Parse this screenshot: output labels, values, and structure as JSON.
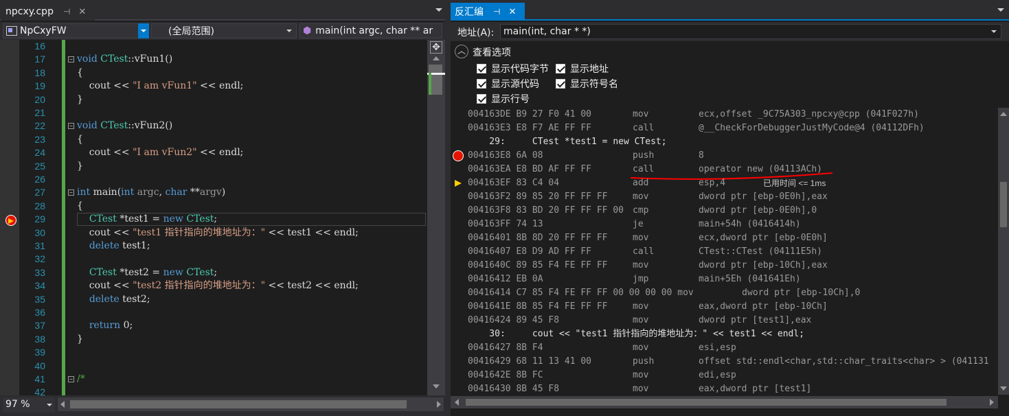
{
  "left_tab": {
    "title": "npcxy.cpp",
    "pin": "⊣",
    "close": "✕"
  },
  "nav": {
    "project": "NpCxyFW",
    "scope": "(全局范围)",
    "member": "main(int argc, char ** ar"
  },
  "code_lines": [
    {
      "n": "16",
      "parts": []
    },
    {
      "n": "17",
      "fold": "−",
      "parts": [
        [
          "kw",
          "void "
        ],
        [
          "ty",
          "CTest"
        ],
        [
          "",
          "::vFun1()"
        ]
      ]
    },
    {
      "n": "18",
      "parts": [
        [
          "",
          "{"
        ]
      ]
    },
    {
      "n": "19",
      "parts": [
        [
          "",
          "    cout << "
        ],
        [
          "st",
          "\"I am vFun1\""
        ],
        [
          "",
          " << endl;"
        ]
      ]
    },
    {
      "n": "20",
      "parts": [
        [
          "",
          "}"
        ]
      ]
    },
    {
      "n": "21",
      "parts": []
    },
    {
      "n": "22",
      "fold": "−",
      "parts": [
        [
          "kw",
          "void "
        ],
        [
          "ty",
          "CTest"
        ],
        [
          "",
          "::vFun2()"
        ]
      ]
    },
    {
      "n": "23",
      "parts": [
        [
          "",
          "{"
        ]
      ]
    },
    {
      "n": "24",
      "parts": [
        [
          "",
          "    cout << "
        ],
        [
          "st",
          "\"I am vFun2\""
        ],
        [
          "",
          " << endl;"
        ]
      ]
    },
    {
      "n": "25",
      "parts": [
        [
          "",
          "}"
        ]
      ]
    },
    {
      "n": "26",
      "parts": []
    },
    {
      "n": "27",
      "fold": "−",
      "parts": [
        [
          "kw",
          "int "
        ],
        [
          "",
          "main("
        ],
        [
          "kw",
          "int "
        ],
        [
          "pa",
          "argc"
        ],
        [
          "",
          ", "
        ],
        [
          "kw",
          "char "
        ],
        [
          "",
          "**"
        ],
        [
          "pa",
          "argv"
        ],
        [
          "",
          ")"
        ]
      ]
    },
    {
      "n": "28",
      "parts": [
        [
          "",
          "{"
        ]
      ]
    },
    {
      "n": "29",
      "current": true,
      "parts": [
        [
          "",
          "    "
        ],
        [
          "ty",
          "CTest"
        ],
        [
          "",
          " *test1 = "
        ],
        [
          "kw",
          "new "
        ],
        [
          "ty",
          "CTest"
        ],
        [
          "",
          ";"
        ]
      ]
    },
    {
      "n": "30",
      "parts": [
        [
          "",
          "    cout << "
        ],
        [
          "st",
          "\"test1 指针指向的堆地址为：\""
        ],
        [
          "",
          " << test1 << endl;"
        ]
      ]
    },
    {
      "n": "31",
      "parts": [
        [
          "",
          "    "
        ],
        [
          "kw",
          "delete "
        ],
        [
          "",
          "test1;"
        ]
      ]
    },
    {
      "n": "32",
      "parts": []
    },
    {
      "n": "33",
      "parts": [
        [
          "",
          "    "
        ],
        [
          "ty",
          "CTest"
        ],
        [
          "",
          " *test2 = "
        ],
        [
          "kw",
          "new "
        ],
        [
          "ty",
          "CTest"
        ],
        [
          "",
          ";"
        ]
      ]
    },
    {
      "n": "34",
      "parts": [
        [
          "",
          "    cout << "
        ],
        [
          "st",
          "\"test2 指针指向的堆地址为：\""
        ],
        [
          "",
          " << test2 << endl;"
        ]
      ]
    },
    {
      "n": "35",
      "parts": [
        [
          "",
          "    "
        ],
        [
          "kw",
          "delete "
        ],
        [
          "",
          "test2;"
        ]
      ]
    },
    {
      "n": "36",
      "parts": []
    },
    {
      "n": "37",
      "parts": [
        [
          "",
          "    "
        ],
        [
          "kw",
          "return "
        ],
        [
          "",
          "0;"
        ]
      ]
    },
    {
      "n": "38",
      "parts": [
        [
          "",
          "}"
        ]
      ]
    },
    {
      "n": "39",
      "parts": []
    },
    {
      "n": "40",
      "parts": []
    },
    {
      "n": "41",
      "fold": "−",
      "parts": [
        [
          "cm",
          "/*"
        ]
      ]
    },
    {
      "n": "42",
      "parts": []
    }
  ],
  "zoom": "97 %",
  "right_tab": {
    "title": "反汇编",
    "pin": "⊣",
    "close": "✕"
  },
  "address": {
    "label": "地址(A):",
    "value": "main(int, char * *)"
  },
  "view_options": {
    "header": "查看选项",
    "items": [
      {
        "label": "显示代码字节",
        "checked": true
      },
      {
        "label": "显示地址",
        "checked": true
      },
      {
        "label": "显示源代码",
        "checked": true
      },
      {
        "label": "显示符号名",
        "checked": true
      },
      {
        "label": "显示行号",
        "checked": true
      }
    ]
  },
  "disasm": [
    {
      "t": "i",
      "a": "004163DE B9 27 F0 41 00",
      "m": "mov",
      "o": "ecx,offset _9C75A303_npcxy@cpp (041F027h)"
    },
    {
      "t": "i",
      "a": "004163E3 E8 F7 AE FF FF",
      "m": "call",
      "o": "@__CheckForDebuggerJustMyCode@4 (04112DFh)"
    },
    {
      "t": "s",
      "text": "    29:     CTest *test1 = new CTest;"
    },
    {
      "t": "i",
      "a": "004163E8 6A 08",
      "m": "push",
      "o": "8",
      "bp": true
    },
    {
      "t": "i",
      "a": "004163EA E8 BD AF FF FF",
      "m": "call",
      "o": "operator new (04113ACh)",
      "underline": true
    },
    {
      "t": "i",
      "a": "004163EF 83 C4 04",
      "m": "add",
      "o": "esp,4",
      "cur": true,
      "elapsed": "已用时间 <= 1ms"
    },
    {
      "t": "i",
      "a": "004163F2 89 85 20 FF FF FF",
      "m": "mov",
      "o": "dword ptr [ebp-0E0h],eax"
    },
    {
      "t": "i",
      "a": "004163F8 83 BD 20 FF FF FF 00",
      "m": "cmp",
      "o": "dword ptr [ebp-0E0h],0"
    },
    {
      "t": "i",
      "a": "004163FF 74 13",
      "m": "je",
      "o": "main+54h (0416414h)"
    },
    {
      "t": "i",
      "a": "00416401 8B 8D 20 FF FF FF",
      "m": "mov",
      "o": "ecx,dword ptr [ebp-0E0h]"
    },
    {
      "t": "i",
      "a": "00416407 E8 D9 AD FF FF",
      "m": "call",
      "o": "CTest::CTest (04111E5h)"
    },
    {
      "t": "i",
      "a": "0041640C 89 85 F4 FE FF FF",
      "m": "mov",
      "o": "dword ptr [ebp-10Ch],eax"
    },
    {
      "t": "i",
      "a": "00416412 EB 0A",
      "m": "jmp",
      "o": "main+5Eh (041641Eh)"
    },
    {
      "t": "w",
      "text": "00416414 C7 85 F4 FE FF FF 00 00 00 00 mov         dword ptr [ebp-10Ch],0"
    },
    {
      "t": "i",
      "a": "0041641E 8B 85 F4 FE FF FF",
      "m": "mov",
      "o": "eax,dword ptr [ebp-10Ch]"
    },
    {
      "t": "i",
      "a": "00416424 89 45 F8",
      "m": "mov",
      "o": "dword ptr [test1],eax"
    },
    {
      "t": "s",
      "text": "    30:     cout << \"test1 指针指向的堆地址为：\" << test1 << endl;"
    },
    {
      "t": "i",
      "a": "00416427 8B F4",
      "m": "mov",
      "o": "esi,esp"
    },
    {
      "t": "i",
      "a": "00416429 68 11 13 41 00",
      "m": "push",
      "o": "offset std::endl<char,std::char_traits<char> > (041131"
    },
    {
      "t": "i",
      "a": "0041642E 8B FC",
      "m": "mov",
      "o": "edi,esp"
    },
    {
      "t": "i",
      "a": "00416430 8B 45 F8",
      "m": "mov",
      "o": "eax,dword ptr [test1]"
    }
  ]
}
